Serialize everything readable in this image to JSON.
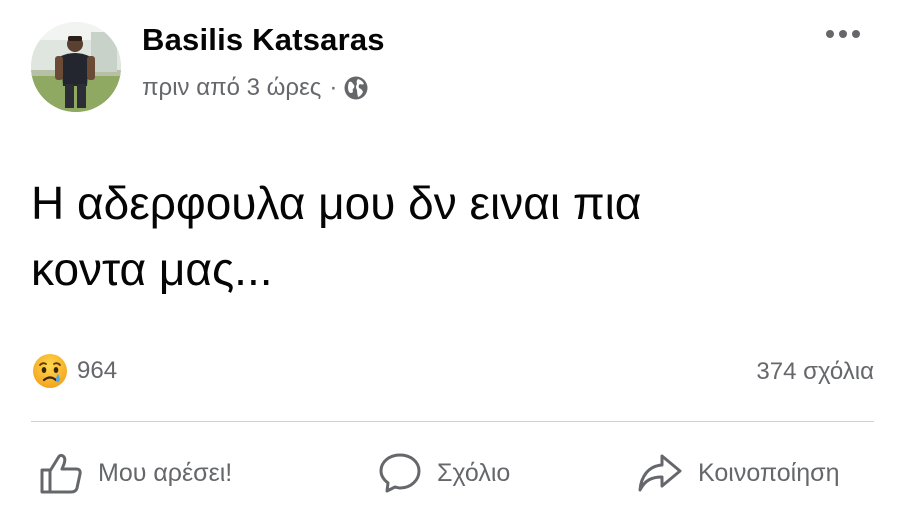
{
  "post": {
    "author": "Basilis Katsaras",
    "timestamp": "πριν από 3 ώρες",
    "separator": "·",
    "privacy_icon": "globe-icon",
    "text": "Η αδερφουλα μου δν ειναι πια\nκοντα μας...",
    "more_icon": "more-options-icon"
  },
  "stats": {
    "reaction_icon": "sad-reaction-icon",
    "reaction_count": "964",
    "comments_count": "374 σχόλια"
  },
  "actions": {
    "like_label": "Μου αρέσει!",
    "comment_label": "Σχόλιο",
    "share_label": "Κοινοποίηση"
  },
  "colors": {
    "text_primary": "#050505",
    "text_secondary": "#65676b",
    "divider": "#ced0d4",
    "sad_reaction": "#f7b125"
  }
}
